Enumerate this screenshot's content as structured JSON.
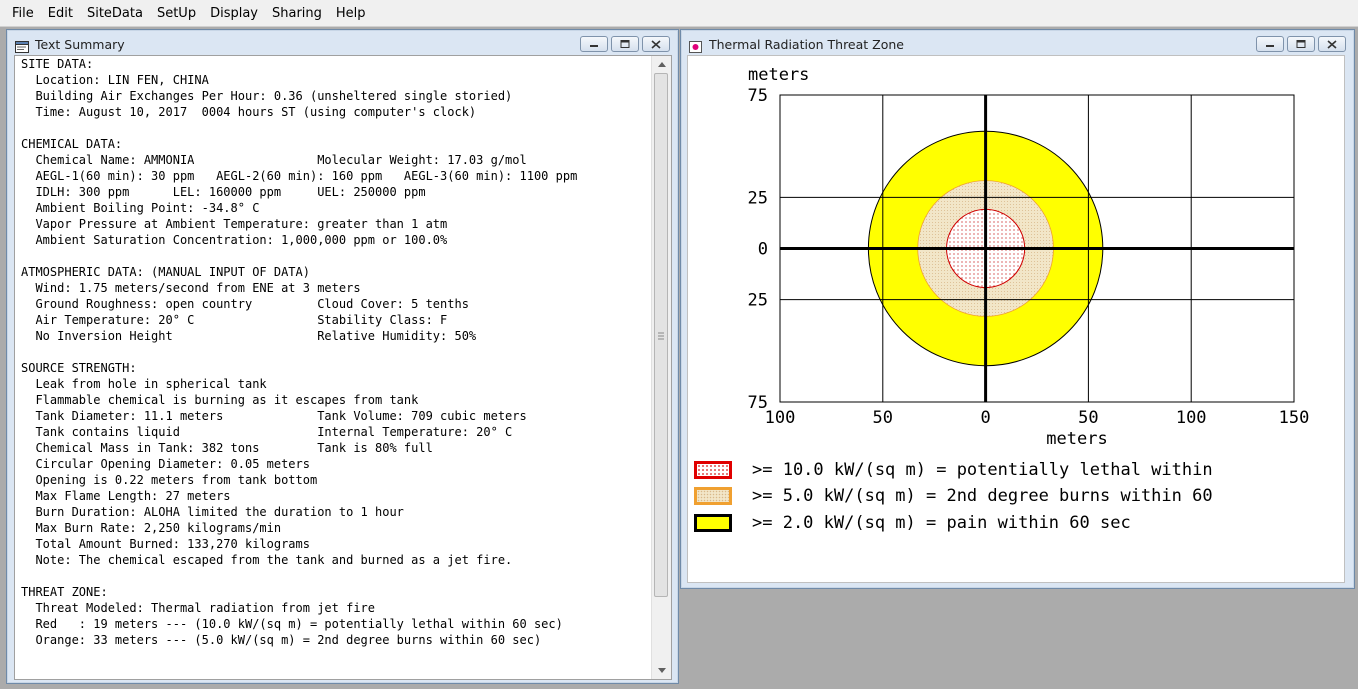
{
  "menu": [
    "File",
    "Edit",
    "SiteData",
    "SetUp",
    "Display",
    "Sharing",
    "Help"
  ],
  "text_summary_window": {
    "title": "Text Summary",
    "lines": [
      "SITE DATA:",
      "  Location: LIN FEN, CHINA",
      "  Building Air Exchanges Per Hour: 0.36 (unsheltered single storied)",
      "  Time: August 10, 2017  0004 hours ST (using computer's clock)",
      "",
      "CHEMICAL DATA:",
      "  Chemical Name: AMMONIA                 Molecular Weight: 17.03 g/mol",
      "  AEGL-1(60 min): 30 ppm   AEGL-2(60 min): 160 ppm   AEGL-3(60 min): 1100 ppm",
      "  IDLH: 300 ppm      LEL: 160000 ppm     UEL: 250000 ppm",
      "  Ambient Boiling Point: -34.8° C",
      "  Vapor Pressure at Ambient Temperature: greater than 1 atm",
      "  Ambient Saturation Concentration: 1,000,000 ppm or 100.0%",
      "",
      "ATMOSPHERIC DATA: (MANUAL INPUT OF DATA)",
      "  Wind: 1.75 meters/second from ENE at 3 meters",
      "  Ground Roughness: open country         Cloud Cover: 5 tenths",
      "  Air Temperature: 20° C                 Stability Class: F",
      "  No Inversion Height                    Relative Humidity: 50%",
      "",
      "SOURCE STRENGTH:",
      "  Leak from hole in spherical tank",
      "  Flammable chemical is burning as it escapes from tank",
      "  Tank Diameter: 11.1 meters             Tank Volume: 709 cubic meters",
      "  Tank contains liquid                   Internal Temperature: 20° C",
      "  Chemical Mass in Tank: 382 tons        Tank is 80% full",
      "  Circular Opening Diameter: 0.05 meters",
      "  Opening is 0.22 meters from tank bottom",
      "  Max Flame Length: 27 meters",
      "  Burn Duration: ALOHA limited the duration to 1 hour",
      "  Max Burn Rate: 2,250 kilograms/min",
      "  Total Amount Burned: 133,270 kilograms",
      "  Note: The chemical escaped from the tank and burned as a jet fire.",
      "",
      "THREAT ZONE:",
      "  Threat Modeled: Thermal radiation from jet fire",
      "  Red   : 19 meters --- (10.0 kW/(sq m) = potentially lethal within 60 sec)",
      "  Orange: 33 meters --- (5.0 kW/(sq m) = 2nd degree burns within 60 sec)"
    ]
  },
  "threat_zone_window": {
    "title": "Thermal Radiation Threat Zone",
    "legend": [
      {
        "label": ">= 10.0 kW/(sq m) = potentially lethal within",
        "fill": "#ffffff",
        "border": "#e00000"
      },
      {
        "label": ">= 5.0 kW/(sq m) = 2nd degree burns within 60",
        "fill": "#f2e6c8",
        "border": "#f0a030"
      },
      {
        "label": ">= 2.0 kW/(sq m) = pain within 60 sec",
        "fill": "#ffff00",
        "border": "#000000"
      }
    ]
  },
  "chart_data": {
    "type": "threat-zone-plot",
    "ylabel": "meters",
    "xlabel": "meters",
    "y_ticks": [
      "75",
      "25",
      "0",
      "25",
      "75"
    ],
    "x_ticks": [
      "100",
      "50",
      "0",
      "50",
      "100",
      "150"
    ],
    "xlim": [
      -100,
      150
    ],
    "ylim": [
      -75,
      75
    ],
    "grid": true,
    "zones": [
      {
        "name": "yellow",
        "radius_m": 57,
        "color": "#ffff00",
        "stroke": "#000000"
      },
      {
        "name": "orange",
        "radius_m": 33,
        "color": "#f2e6c8",
        "stroke": "#f0a030"
      },
      {
        "name": "red",
        "radius_m": 19,
        "color": "#f7eaea",
        "stroke": "#d00000"
      }
    ]
  }
}
